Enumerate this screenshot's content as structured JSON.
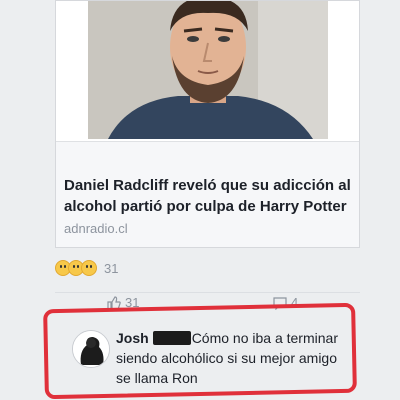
{
  "post": {
    "link_preview": {
      "headline": "Daniel Radcliff reveló que su adicción al alcohol partió por culpa de Harry Potter",
      "domain": "adnradio.cl"
    },
    "reactions": {
      "icons": [
        "wow-emoji-icon",
        "laugh-emoji-icon",
        "sad-emoji-icon"
      ],
      "count": "31"
    },
    "actions": {
      "like_count": "31",
      "comment_count": "4"
    }
  },
  "comment": {
    "author": "Josh",
    "text": "Cómo no   iba a terminar siendo alcohólico si su mejor amigo se llama Ron"
  },
  "colors": {
    "highlight": "#e0303a",
    "headline": "#1d2129",
    "muted": "#8d949e"
  }
}
